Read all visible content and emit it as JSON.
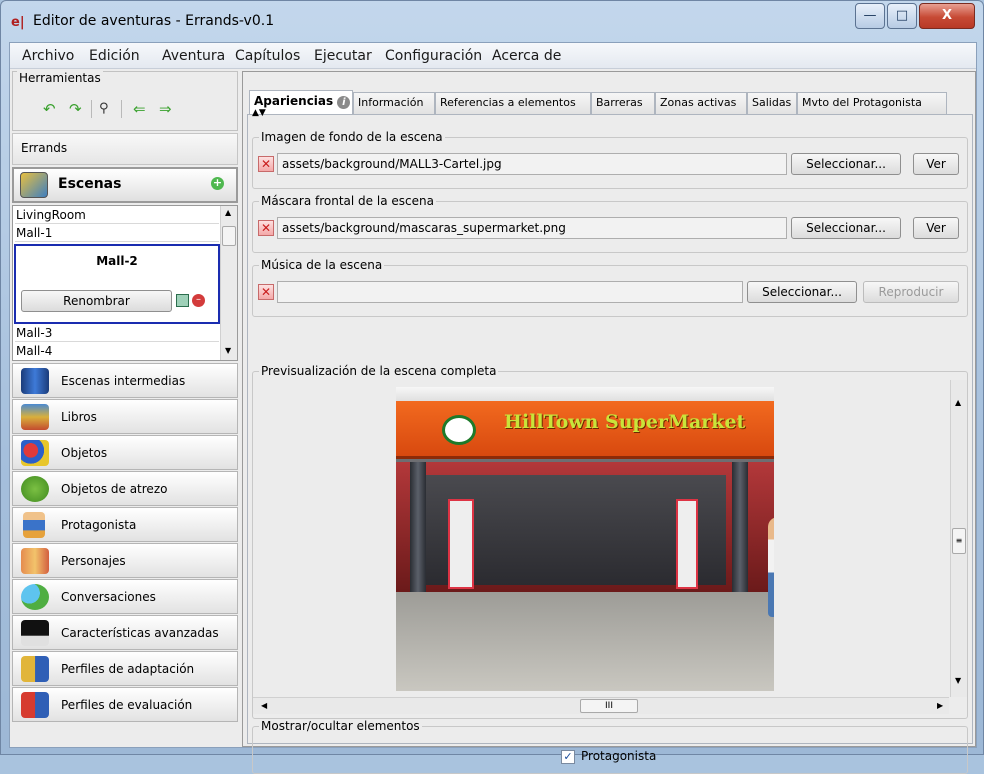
{
  "window": {
    "title": "Editor de aventuras - Errands-v0.1",
    "app_icon": "e|",
    "controls": {
      "minimize": "—",
      "maximize": "□",
      "close": "X"
    }
  },
  "menu": [
    "Archivo",
    "Edición",
    "Aventura",
    "Capítulos",
    "Ejecutar",
    "Configuración",
    "Acerca de"
  ],
  "toolbox": {
    "title": "Herramientas",
    "tools": [
      "undo-icon",
      "redo-icon",
      "find-icon",
      "back-icon",
      "forward-icon"
    ]
  },
  "project": {
    "name": "Errands"
  },
  "scenes": {
    "header": "Escenas",
    "items": [
      "LivingRoom",
      "Mall-1",
      "Mall-2",
      "Mall-3",
      "Mall-4"
    ],
    "selected": "Mall-2",
    "rename_label": "Renombrar"
  },
  "nav": [
    {
      "label": "Escenas intermedias",
      "icon": "film-icon"
    },
    {
      "label": "Libros",
      "icon": "books-icon"
    },
    {
      "label": "Objetos",
      "icon": "shapes-icon"
    },
    {
      "label": "Objetos de atrezo",
      "icon": "tree-icon"
    },
    {
      "label": "Protagonista",
      "icon": "protagonist-icon"
    },
    {
      "label": "Personajes",
      "icon": "characters-icon"
    },
    {
      "label": "Conversaciones",
      "icon": "speech-bubbles-icon"
    },
    {
      "label": "Características avanzadas",
      "icon": "magic-hat-icon"
    },
    {
      "label": "Perfiles de adaptación",
      "icon": "adaptation-profile-icon"
    },
    {
      "label": "Perfiles de evaluación",
      "icon": "evaluation-profile-icon"
    }
  ],
  "tabs": [
    "Apariencias",
    "Información",
    "Referencias a elementos",
    "Barreras",
    "Zonas activas",
    "Salidas",
    "Mvto del Protagonista"
  ],
  "background": {
    "title": "Imagen de fondo de la escena",
    "path": "assets/background/MALL3-Cartel.jpg",
    "select": "Seleccionar...",
    "view": "Ver"
  },
  "mask": {
    "title": "Máscara frontal de la escena",
    "path": "assets/background/mascaras_supermarket.png",
    "select": "Seleccionar...",
    "view": "Ver"
  },
  "music": {
    "title": "Música de la escena",
    "path": "",
    "select": "Seleccionar...",
    "play": "Reproducir"
  },
  "preview": {
    "title": "Previsualización de la escena completa",
    "store_sign": "HillTown SuperMarket",
    "scroll_label": "III"
  },
  "show_hide": {
    "title": "Mostrar/ocultar elementos",
    "checkbox_label": "Protagonista",
    "checked": true
  }
}
